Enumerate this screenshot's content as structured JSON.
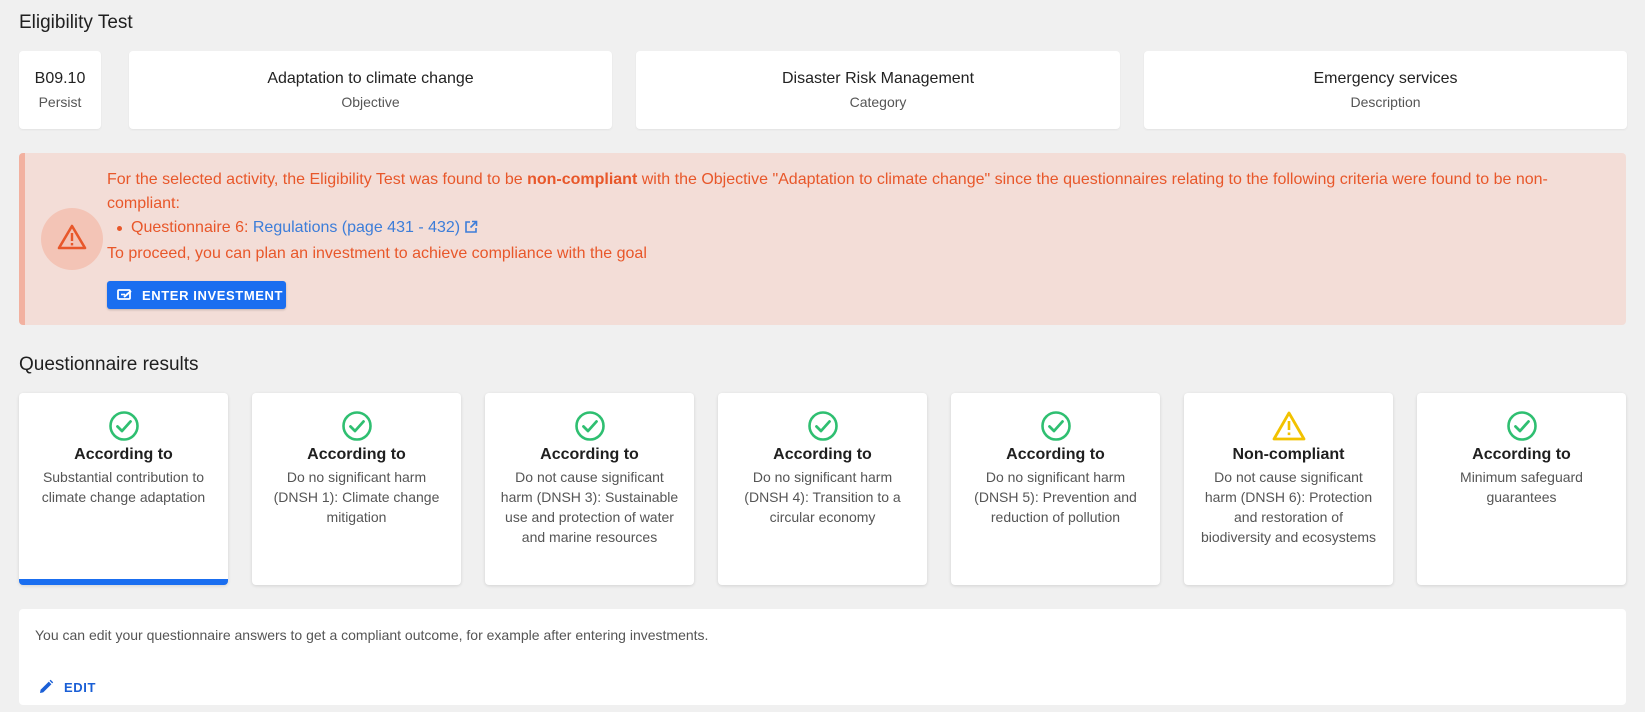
{
  "page": {
    "title": "Eligibility Test"
  },
  "info_cards": [
    {
      "value": "B09.10",
      "label": "Persist"
    },
    {
      "value": "Adaptation to climate change",
      "label": "Objective"
    },
    {
      "value": "Disaster Risk Management",
      "label": "Category"
    },
    {
      "value": "Emergency services",
      "label": "Description"
    }
  ],
  "alert": {
    "text_pre": "For the selected activity, the Eligibility Test was found to be ",
    "text_bold": "non-compliant",
    "text_post": " with the Objective \"Adaptation to climate change\" since the questionnaires relating to the following criteria were found to be non-compliant:",
    "item_prefix": "Questionnaire 6: ",
    "item_link": "Regulations (page 431 - 432)",
    "proceed_text": "To proceed, you can plan an investment to achieve compliance with the goal",
    "button_label": "ENTER INVESTMENT",
    "colors": {
      "text": "#e8572a",
      "background": "#f3ddd7",
      "link": "#3c7dd9"
    }
  },
  "questionnaire": {
    "title": "Questionnaire results",
    "cards": [
      {
        "status": "According to",
        "icon": "check-circle-icon",
        "description": "Substantial contribution to climate change adaptation",
        "selected": true
      },
      {
        "status": "According to",
        "icon": "check-circle-icon",
        "description": "Do no significant harm (DNSH 1): Climate change mitigation",
        "selected": false
      },
      {
        "status": "According to",
        "icon": "check-circle-icon",
        "description": "Do not cause significant harm (DNSH 3): Sustainable use and protection of water and marine resources",
        "selected": false
      },
      {
        "status": "According to",
        "icon": "check-circle-icon",
        "description": "Do no significant harm (DNSH 4): Transition to a circular economy",
        "selected": false
      },
      {
        "status": "According to",
        "icon": "check-circle-icon",
        "description": "Do no significant harm (DNSH 5): Prevention and reduction of pollution",
        "selected": false
      },
      {
        "status": "Non-compliant",
        "icon": "warning-icon",
        "description": "Do not cause significant harm (DNSH 6): Protection and restoration of biodiversity and ecosystems",
        "selected": false
      },
      {
        "status": "According to",
        "icon": "check-circle-icon",
        "description": "Minimum safeguard guarantees",
        "selected": false
      }
    ],
    "colors": {
      "compliant": "#2fbf71",
      "warning": "#f2c200",
      "selected_bar": "#1a6ef0"
    }
  },
  "bottom": {
    "text": "You can edit your questionnaire answers to get a compliant outcome, for example after entering investments.",
    "edit_label": "EDIT"
  }
}
